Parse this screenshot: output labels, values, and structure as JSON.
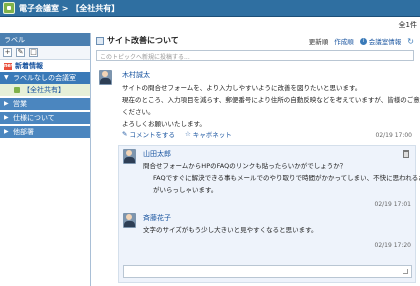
{
  "titlebar": {
    "title": "電子会議室 > 【全社共有】"
  },
  "subbar": {
    "count": "全1件"
  },
  "sidebar": {
    "header": "ラベル",
    "toolbar": {
      "add": "+",
      "edit": "✎",
      "delete": "□"
    },
    "new_arrivals": {
      "icon": "new",
      "label": "新着情報"
    },
    "tree": [
      {
        "label": "ラベルなしの会議室",
        "toggle": "▼"
      },
      {
        "label": "【全社共有】"
      }
    ],
    "groups": [
      {
        "label": "営業",
        "toggle": "▶"
      },
      {
        "label": "仕様について",
        "toggle": "▶"
      },
      {
        "label": "他部署",
        "toggle": "▶"
      }
    ]
  },
  "topic": {
    "title": "サイト改善について",
    "links": {
      "history": "更新順",
      "author": "作成順",
      "info": "会議室情報"
    },
    "input_placeholder": "このトピックへ新規に投稿する..."
  },
  "first_post": {
    "author": "木村誠太",
    "lines": [
      "サイトの問合せフォームを、より入力しやすいように改善を図りたいと思います。",
      "現在のところ、入力項目を減らす、郵便番号により住所の自動反映などを考えていますが、皆様のご意見を",
      "ください。",
      "よろしくお願いいたします。"
    ],
    "actions": {
      "comment": "コメントをする",
      "like": "キャボネット"
    },
    "timestamp": "02/19 17:00"
  },
  "replies": [
    {
      "author": "山田太郎",
      "lines": [
        "問合せフォームからHPのFAQのリンクも貼ったらいかがでしょうか？",
        "FAQですぐに解決できる事もメールでのやり取りで時間がかかってしまい、不快に思われるお客様",
        "がいらっしゃいます。"
      ],
      "timestamp": "02/19 17:01"
    },
    {
      "author": "斉藤花子",
      "lines": [
        "文字のサイズがもう少し大きいと見やすくなると思います。"
      ],
      "timestamp": "02/19 17:20"
    }
  ]
}
